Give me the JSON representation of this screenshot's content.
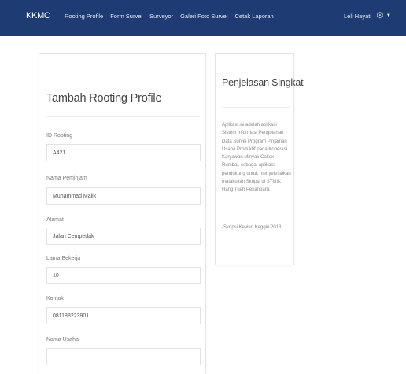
{
  "navbar": {
    "brand": "KKMC",
    "items": [
      "Rooting Profile",
      "Form Survei",
      "Surveyor",
      "Galeri Foto Survei",
      "Cetak Laporan"
    ],
    "user": "Leli Hayati",
    "settings_icon": "gear-icon",
    "bg_color": "#1f3b73"
  },
  "form": {
    "title": "Tambah Rooting Profile",
    "fields": [
      {
        "label": "ID Rooting",
        "value": "A421"
      },
      {
        "label": "Nama Peminjam",
        "value": "Muhammad Malik"
      },
      {
        "label": "Alamat",
        "value": "Jalan Cempedak"
      },
      {
        "label": "Lama Bekerja",
        "value": "10"
      },
      {
        "label": "Kontak",
        "value": "081188223901"
      },
      {
        "label": "Nama Usaha",
        "value": ""
      }
    ]
  },
  "info": {
    "title": "Penjelasan Singkat",
    "body": "Aplikasi ini adalah aplikasi Sistem Informasi Pengolahan Data Survei Program Pinjaman Usaha Produktif pada Koperasi Karyawan Minyak Caltex Rumbai, sebagai aplikasi pendukung untuk menyelesaikan matakuliah Skripsi di STMIK Hang Tuah Pekanbaru.",
    "signature": "-Skripsi Kevien Keggin 2018"
  }
}
